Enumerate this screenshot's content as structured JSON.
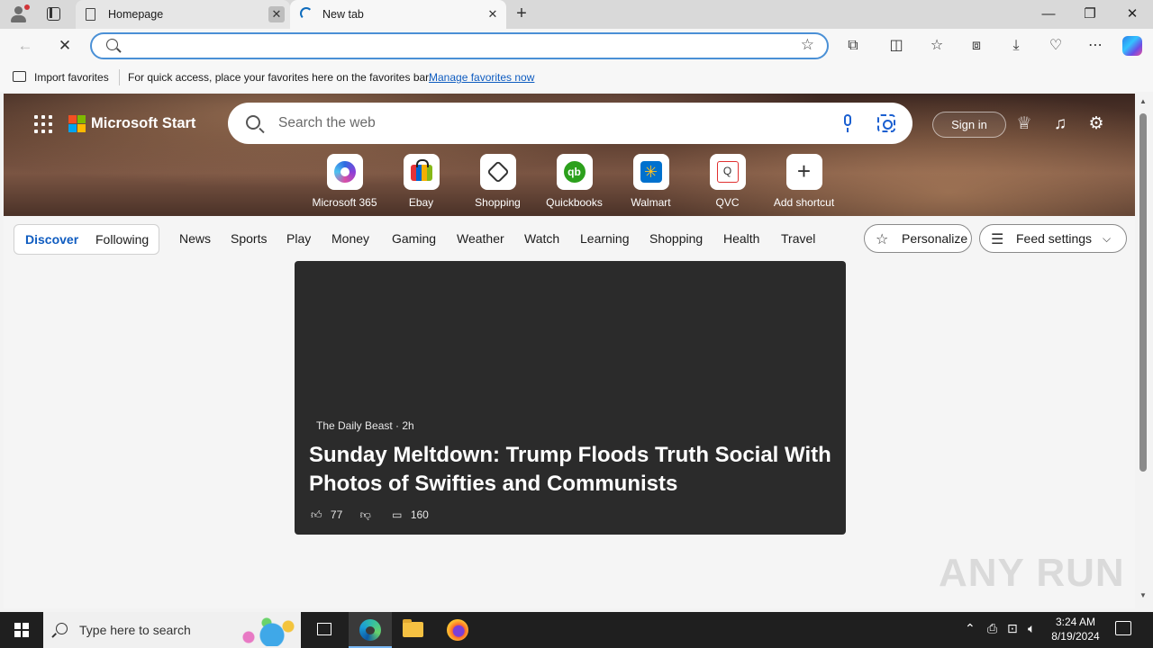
{
  "browser": {
    "tabs": [
      {
        "title": "Homepage",
        "state": "inactive"
      },
      {
        "title": "New tab",
        "state": "loading"
      }
    ],
    "new_tab_glyph": "+",
    "window_controls": {
      "minimize": "—",
      "maximize": "❐",
      "close": "✕"
    },
    "address": {
      "value": "",
      "placeholder": ""
    },
    "nav": {
      "back": "←",
      "stop": "✕"
    }
  },
  "favorites_bar": {
    "import_label": "Import favorites",
    "message": "For quick access, place your favorites here on the favorites bar.",
    "manage_link": "Manage favorites now"
  },
  "page": {
    "brand": "Microsoft Start",
    "search_placeholder": "Search the web",
    "sign_in": "Sign in",
    "shortcuts": [
      {
        "label": "Microsoft 365",
        "icon": "microsoft365-icon"
      },
      {
        "label": "Ebay",
        "icon": "ebay-icon"
      },
      {
        "label": "Shopping",
        "icon": "shopping-tag-icon"
      },
      {
        "label": "Quickbooks",
        "icon": "quickbooks-icon",
        "glyph": "qb"
      },
      {
        "label": "Walmart",
        "icon": "walmart-icon",
        "glyph": "✳"
      },
      {
        "label": "QVC",
        "icon": "qvc-icon",
        "glyph": "Q"
      },
      {
        "label": "Add shortcut",
        "icon": "add-icon",
        "glyph": "+"
      }
    ],
    "feed_tabs": {
      "discover": "Discover",
      "following": "Following"
    },
    "categories": [
      "News",
      "Sports",
      "Play",
      "Money",
      "Gaming",
      "Weather",
      "Watch",
      "Learning",
      "Shopping",
      "Health",
      "Travel"
    ],
    "personalize": "Personalize",
    "feed_settings": "Feed settings",
    "card": {
      "source": "The Daily Beast · 2h",
      "headline": "Sunday Meltdown: Trump Floods Truth Social With Photos of Swifties and Communists",
      "likes": "77",
      "comments": "160"
    },
    "watermark": "ANY RUN"
  },
  "taskbar": {
    "search_placeholder": "Type here to search",
    "time": "3:24 AM",
    "date": "8/19/2024"
  },
  "colors": {
    "accent": "#0f5cc0",
    "omnibox_border": "#4a90d6",
    "taskbar": "#1f1f1f"
  }
}
